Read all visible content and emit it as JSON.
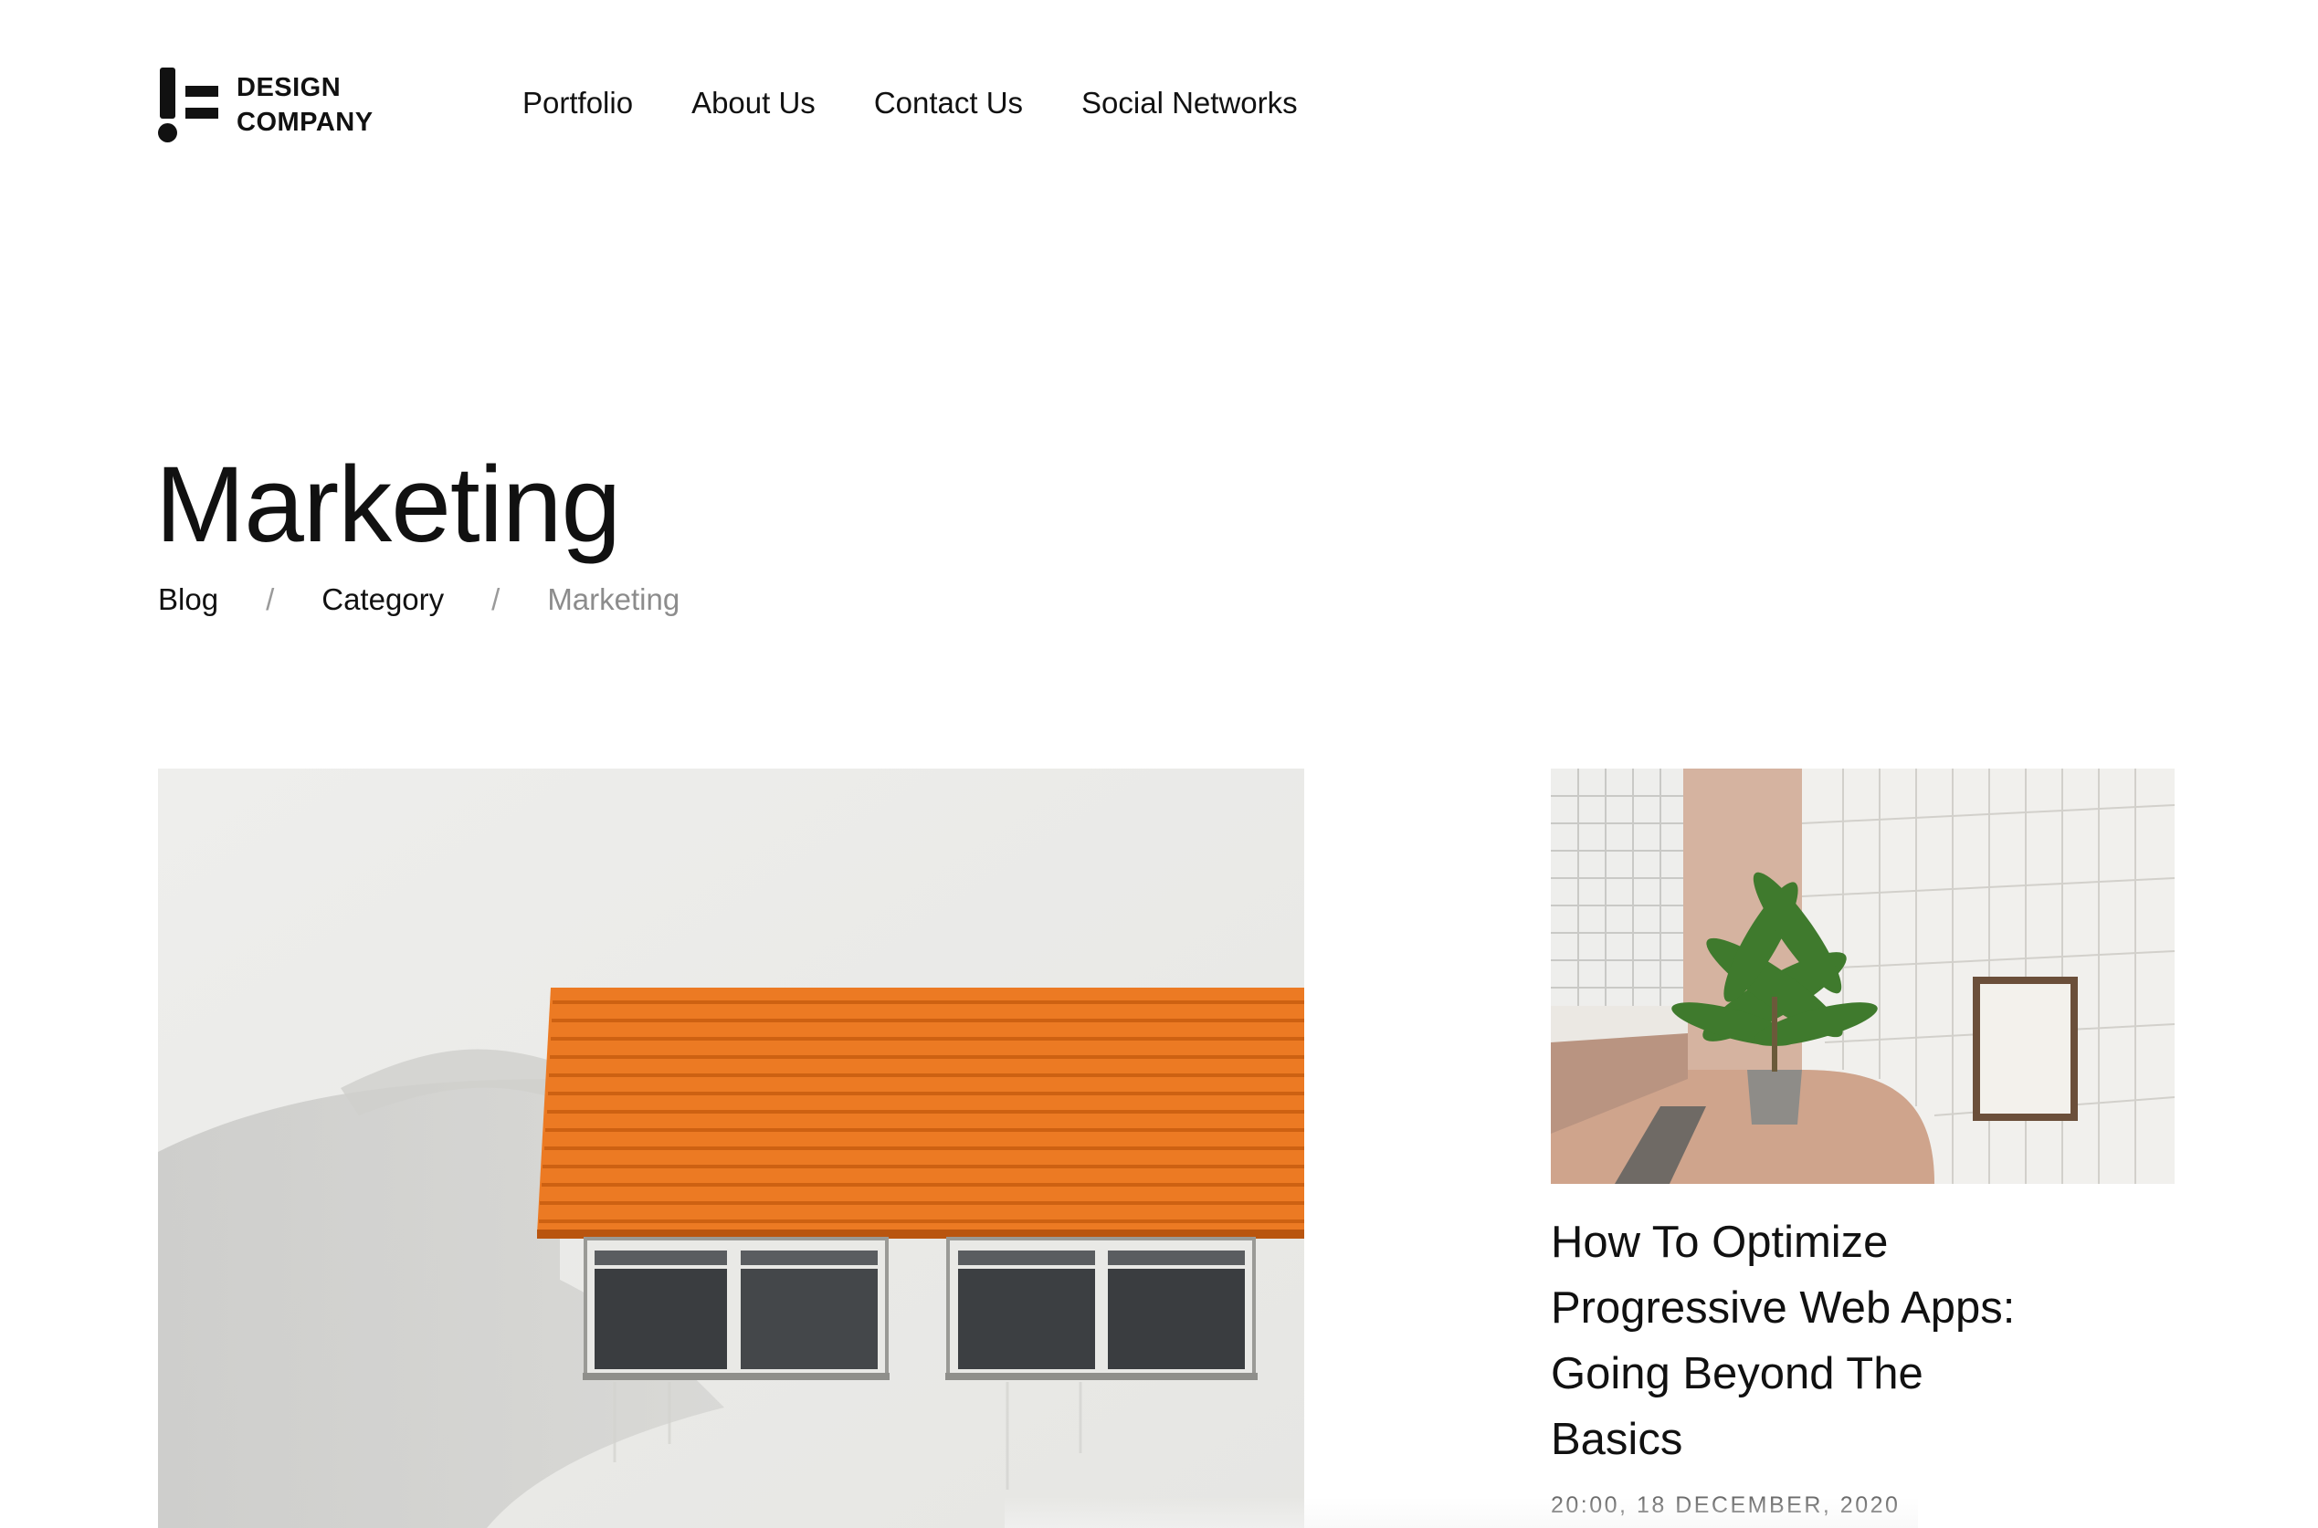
{
  "brand": {
    "line1": "DESIGN",
    "line2": "COMPANY",
    "logo_icon": "exclamation-lines-logo-icon"
  },
  "nav": {
    "items": [
      {
        "label": "Portfolio"
      },
      {
        "label": "About Us"
      },
      {
        "label": "Contact Us"
      },
      {
        "label": "Social Networks"
      }
    ]
  },
  "page": {
    "title": "Marketing"
  },
  "breadcrumb": {
    "items": [
      {
        "label": "Blog"
      },
      {
        "label": "Category"
      },
      {
        "label": "Marketing"
      }
    ],
    "separator": "/"
  },
  "featured": {
    "image_icon": "orange-awning-building-image"
  },
  "side_post": {
    "image_icon": "plant-tiled-room-image",
    "title": "How To Optimize Progressive Web Apps: Going Beyond The Basics",
    "date": "20:00, 18 DECEMBER, 2020"
  },
  "colors": {
    "text": "#111111",
    "muted": "#8c8c8c",
    "accent_orange": "#f07a1e"
  }
}
